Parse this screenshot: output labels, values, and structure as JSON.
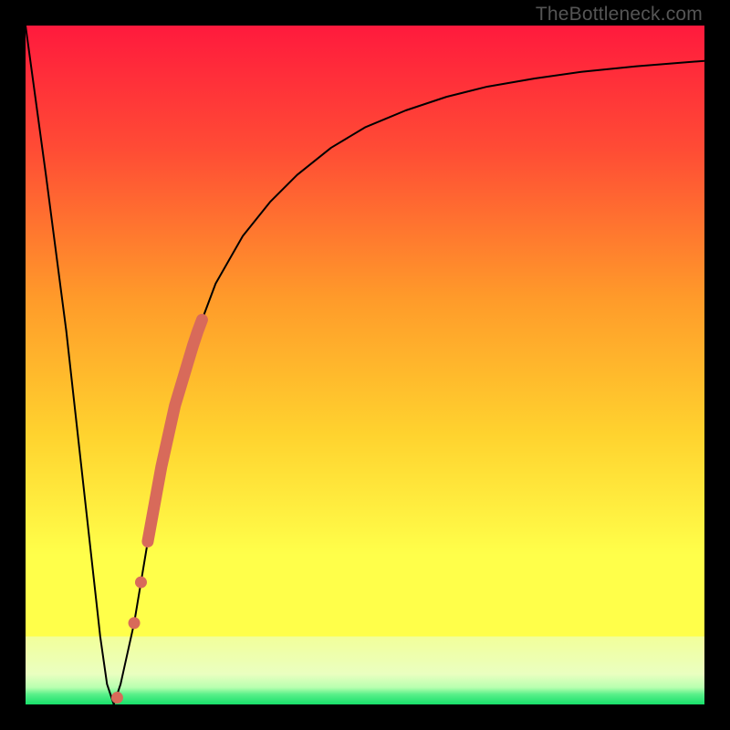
{
  "watermark": "TheBottleneck.com",
  "colors": {
    "top": "#ff1a3d",
    "mid1": "#ff7a2a",
    "mid2": "#ffd22e",
    "mid3": "#ffff4a",
    "band": "#f4ff88",
    "bottom": "#17e06a",
    "curve": "#000000",
    "dot": "#d86a5a",
    "frame": "#000000"
  },
  "chart_data": {
    "type": "line",
    "title": "",
    "xlabel": "",
    "ylabel": "",
    "xlim": [
      0,
      100
    ],
    "ylim": [
      0,
      100
    ],
    "series": [
      {
        "name": "bottleneck-curve",
        "x": [
          0,
          3,
          6,
          9,
          11,
          12,
          13,
          14,
          16,
          18,
          20,
          22,
          25,
          28,
          32,
          36,
          40,
          45,
          50,
          56,
          62,
          68,
          75,
          82,
          90,
          100
        ],
        "y": [
          100,
          78,
          55,
          28,
          10,
          3,
          0,
          3,
          12,
          24,
          35,
          44,
          54,
          62,
          69,
          74,
          78,
          82,
          85,
          87.5,
          89.5,
          91,
          92.2,
          93.2,
          94,
          94.8
        ]
      }
    ],
    "annotations": {
      "highlight_segment": {
        "description": "thick salmon stroke on rising branch",
        "x_range": [
          18,
          26
        ],
        "y_range": [
          24,
          56
        ]
      },
      "dots": [
        {
          "x": 16.0,
          "y": 12
        },
        {
          "x": 17.0,
          "y": 18
        },
        {
          "x": 13.5,
          "y": 1
        }
      ]
    }
  }
}
